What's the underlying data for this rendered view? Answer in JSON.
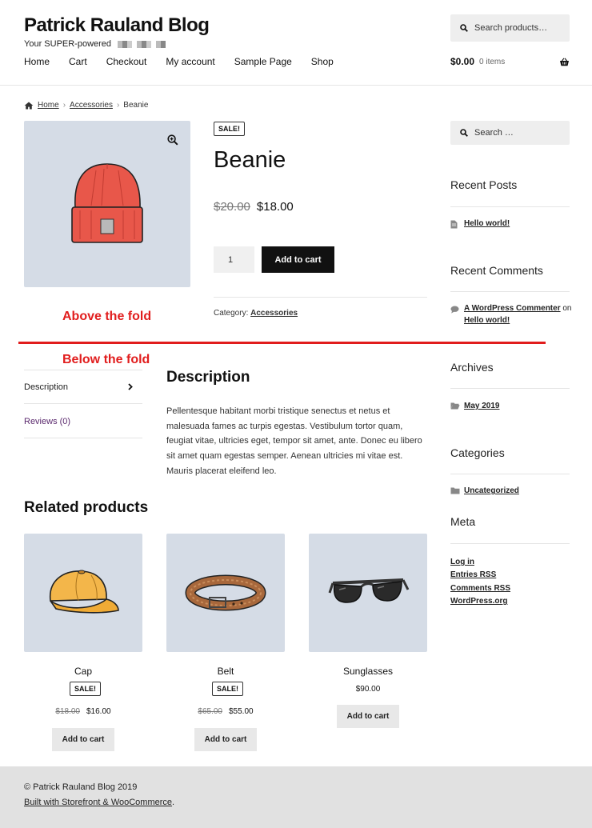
{
  "header": {
    "site_title": "Patrick Rauland Blog",
    "tagline": "Your SUPER-powered",
    "search_placeholder": "Search products…",
    "nav": [
      "Home",
      "Cart",
      "Checkout",
      "My account",
      "Sample Page",
      "Shop"
    ],
    "cart_amount": "$0.00",
    "cart_items": "0 items"
  },
  "breadcrumb": {
    "home": "Home",
    "category": "Accessories",
    "current": "Beanie"
  },
  "product": {
    "badge": "SALE!",
    "title": "Beanie",
    "old_price": "$20.00",
    "new_price": "$18.00",
    "quantity": "1",
    "add_to_cart": "Add to cart",
    "category_label": "Category:",
    "category": "Accessories"
  },
  "annotation": {
    "above": "Above the fold",
    "below": "Below the fold",
    "color": "#e11d1d"
  },
  "tabs": {
    "description": "Description",
    "reviews": "Reviews (0)"
  },
  "description": {
    "title": "Description",
    "body": "Pellentesque habitant morbi tristique senectus et netus et malesuada fames ac turpis egestas. Vestibulum tortor quam, feugiat vitae, ultricies eget, tempor sit amet, ante. Donec eu libero sit amet quam egestas semper. Aenean ultricies mi vitae est. Mauris placerat eleifend leo."
  },
  "sidebar": {
    "search_placeholder": "Search …",
    "recent_posts_title": "Recent Posts",
    "recent_post": "Hello world!",
    "recent_comments_title": "Recent Comments",
    "comment_author": "A WordPress Commenter",
    "comment_on": "on",
    "comment_post": "Hello world!",
    "archives_title": "Archives",
    "archive": "May 2019",
    "categories_title": "Categories",
    "category": "Uncategorized",
    "meta_title": "Meta",
    "meta_links": [
      "Log in",
      "Entries RSS",
      "Comments RSS",
      "WordPress.org"
    ]
  },
  "related": {
    "title": "Related products",
    "products": [
      {
        "name": "Cap",
        "badge": "SALE!",
        "old_price": "$18.00",
        "price": "$16.00",
        "button": "Add to cart"
      },
      {
        "name": "Belt",
        "badge": "SALE!",
        "old_price": "$65.00",
        "price": "$55.00",
        "button": "Add to cart"
      },
      {
        "name": "Sunglasses",
        "price": "$90.00",
        "button": "Add to cart"
      }
    ]
  },
  "footer": {
    "copyright": "© Patrick Rauland Blog 2019",
    "built_with": "Built with Storefront & WooCommerce",
    "period": "."
  },
  "colors": {
    "accent": "#111111",
    "image_bg": "#d5dce6",
    "reviews_link": "#5b2a6e",
    "footer_bg": "#e1e1e1"
  }
}
